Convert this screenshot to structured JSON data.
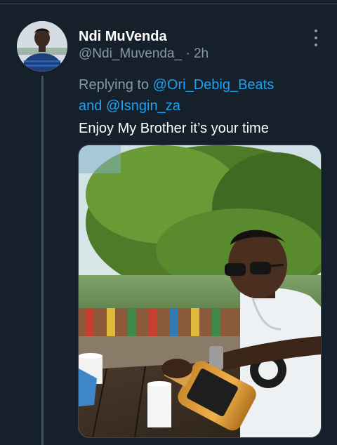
{
  "tweet": {
    "display_name": "Ndi MuVenda",
    "handle": "@Ndi_Muvenda_",
    "separator": "·",
    "time_ago": "2h",
    "replying_prefix": "Replying to",
    "reply_to_1": "@Ori_Debig_Beats",
    "reply_conjunction": "and",
    "reply_to_2": "@Isngin_za",
    "text": "Enjoy My Brother it’s your time"
  },
  "icons": {
    "more": "more-vertical-icon"
  },
  "colors": {
    "background": "#15202b",
    "primary_text": "#ffffff",
    "secondary_text": "#8899a6",
    "link": "#1da1f2",
    "thread_line": "#3d5466"
  }
}
